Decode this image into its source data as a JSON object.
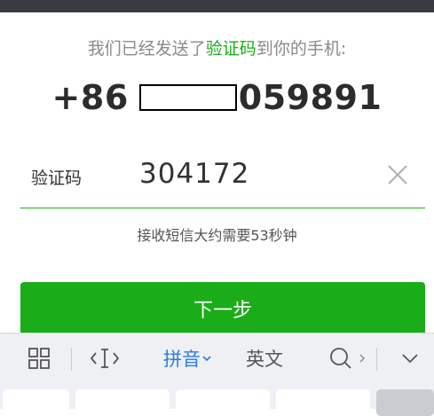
{
  "notice": {
    "prefix": "我们已经发送了",
    "highlight": "验证码",
    "suffix": "到你的手机:"
  },
  "phone": {
    "country_code": "+86",
    "visible_suffix": "059891"
  },
  "code_field": {
    "label": "验证码",
    "value": "304172"
  },
  "hint": "接收短信大约需要53秒钟",
  "next_button": "下一步",
  "keyboard": {
    "pinyin_label": "拼音",
    "english_label": "英文"
  },
  "colors": {
    "accent": "#1aad19",
    "keyboard_accent": "#2c7be5"
  }
}
